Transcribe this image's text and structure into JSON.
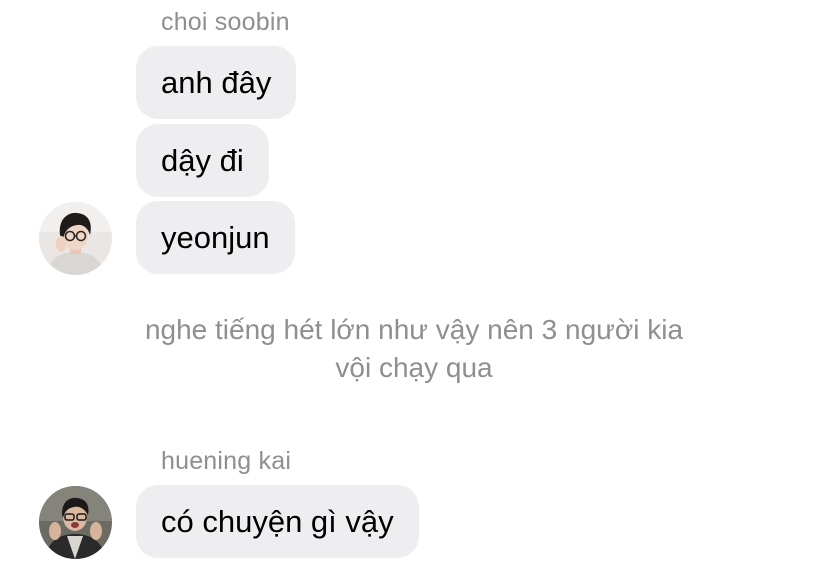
{
  "group1": {
    "sender": "choi soobin",
    "messages": [
      "anh đây",
      "dậy đi",
      "yeonjun"
    ],
    "avatar_icon": "profile-photo-soobin"
  },
  "system_message": {
    "line1": "nghe tiếng hét lớn như vậy nên 3 người kia",
    "line2": "vội chạy qua"
  },
  "group2": {
    "sender": "huening kai",
    "messages": [
      "có chuyện gì vậy"
    ],
    "avatar_icon": "profile-photo-kai"
  },
  "colors": {
    "bubble_bg": "#eeeef0",
    "sender_text": "#8e8e93",
    "message_text": "#000000",
    "background": "#ffffff"
  }
}
